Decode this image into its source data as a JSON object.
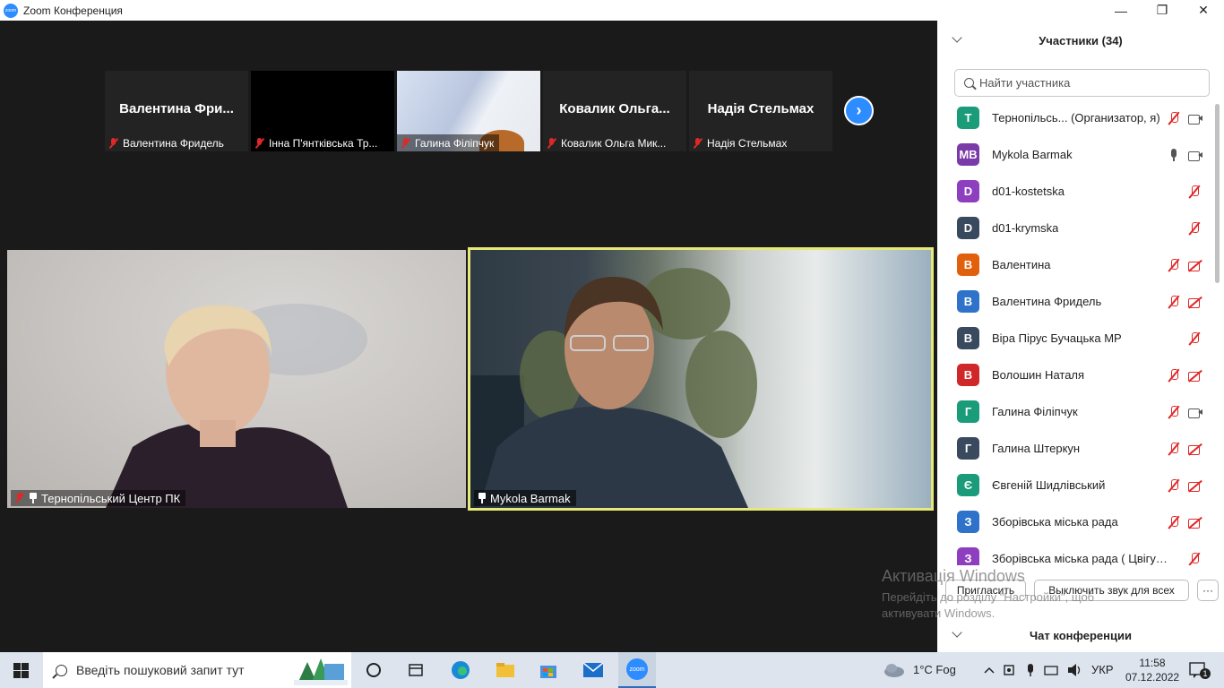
{
  "window": {
    "title": "Zoom Конференция",
    "logo_text": "zoom",
    "minimize": "—",
    "maximize": "❐",
    "close": "✕"
  },
  "thumbnails": [
    {
      "display_name": "Валентина  Фри...",
      "label": "Валентина Фридель"
    },
    {
      "display_name": "",
      "label": "Інна П'янтківська Тр..."
    },
    {
      "display_name": "",
      "label": "Галина Філіпчук"
    },
    {
      "display_name": "Ковалик  Ольга...",
      "label": "Ковалик Ольга Мик..."
    },
    {
      "display_name": "Надія Стельмах",
      "label": "Надія Стельмах"
    }
  ],
  "next_button": "›",
  "main_videos": [
    {
      "label": "Тернопільський Центр ПК"
    },
    {
      "label": "Mykola Barmak"
    }
  ],
  "participants_panel": {
    "title": "Участники (34)",
    "search_placeholder": "Найти участника",
    "participants": [
      {
        "initials": "T",
        "color": "#1a9c7a",
        "name": "Тернопільсь...  (Организатор, я)",
        "mic": "muted",
        "cam": "on"
      },
      {
        "initials": "MB",
        "color": "#7a3aa8",
        "name": "Mykola Barmak",
        "mic": "on",
        "cam": "on"
      },
      {
        "initials": "D",
        "color": "#8e3fbf",
        "name": "d01-kostetska",
        "mic": "muted",
        "cam": "none"
      },
      {
        "initials": "D",
        "color": "#3a4a5e",
        "name": "d01-krymska",
        "mic": "muted",
        "cam": "none"
      },
      {
        "initials": "В",
        "color": "#e0600e",
        "name": "Валентина",
        "mic": "muted",
        "cam": "off"
      },
      {
        "initials": "В",
        "color": "#2e73c9",
        "name": "Валентина Фридель",
        "mic": "muted",
        "cam": "off"
      },
      {
        "initials": "В",
        "color": "#3a4a5e",
        "name": "Віра Пірус Бучацька МР",
        "mic": "muted",
        "cam": "none"
      },
      {
        "initials": "В",
        "color": "#d02828",
        "name": "Волошин Наталя",
        "mic": "muted",
        "cam": "off"
      },
      {
        "initials": "Г",
        "color": "#1a9c7a",
        "name": "Галина Філіпчук",
        "mic": "muted",
        "cam": "on"
      },
      {
        "initials": "Г",
        "color": "#3a4a5e",
        "name": "Галина Штеркун",
        "mic": "muted",
        "cam": "off"
      },
      {
        "initials": "Є",
        "color": "#1a9c7a",
        "name": "Євгеній Шидлівський",
        "mic": "muted",
        "cam": "off"
      },
      {
        "initials": "З",
        "color": "#2e73c9",
        "name": "Зборівська міська рада",
        "mic": "muted",
        "cam": "off"
      },
      {
        "initials": "З",
        "color": "#8e3fbf",
        "name": "Зборівська міська рада ( Цвігун,С...",
        "mic": "muted",
        "cam": "none"
      }
    ],
    "invite_button": "Пригласить",
    "mute_all_button": "Выключить звук для всех",
    "more_button": "···"
  },
  "activation": {
    "line1": "Активація Windows",
    "line2": "Перейдіть до розділу \"Настройки\", щоб",
    "line3": "активувати Windows."
  },
  "chat_panel": {
    "title": "Чат конференции"
  },
  "taskbar": {
    "search_placeholder": "Введіть пошуковий запит тут",
    "weather": "1°C  Fog",
    "language": "УКР",
    "time": "11:58",
    "date": "07.12.2022",
    "notifications": "1",
    "zoom_icon_text": "zoom"
  }
}
